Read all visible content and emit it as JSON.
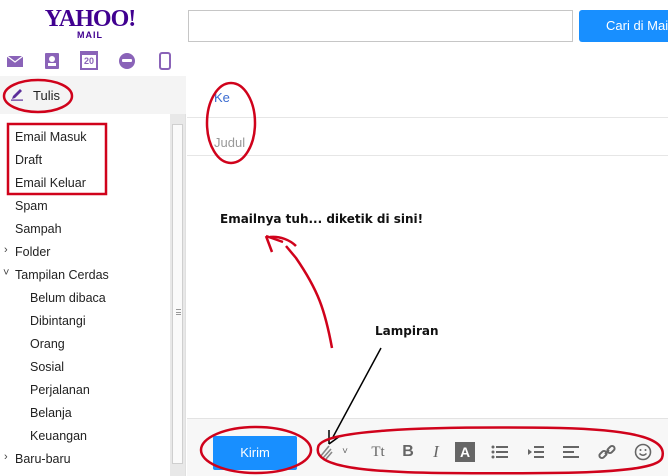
{
  "header": {
    "logo_main": "YAHOO!",
    "logo_sub": "MAIL",
    "search_button": "Cari di Mail",
    "search_value": ""
  },
  "apps": [
    "mail-icon",
    "contacts-icon",
    "calendar-icon",
    "messenger-icon",
    "mobile-icon"
  ],
  "calendar_day": "20",
  "sidebar": {
    "compose_label": "Tulis",
    "folders": [
      {
        "label": "Email Masuk"
      },
      {
        "label": "Draft"
      },
      {
        "label": "Email Keluar"
      },
      {
        "label": "Spam"
      },
      {
        "label": "Sampah"
      },
      {
        "label": "Folder"
      },
      {
        "label": "Tampilan Cerdas"
      },
      {
        "label": "Belum dibaca"
      },
      {
        "label": "Dibintangi"
      },
      {
        "label": "Orang"
      },
      {
        "label": "Sosial"
      },
      {
        "label": "Perjalanan"
      },
      {
        "label": "Belanja"
      },
      {
        "label": "Keuangan"
      },
      {
        "label": "Baru-baru"
      }
    ]
  },
  "compose": {
    "to_label": "Ke",
    "subject_placeholder": "Judul",
    "body_text": "Emailnya tuh... diketik di sini!",
    "attachment_annotation": "Lampiran",
    "send_label": "Kirim",
    "toolbar": {
      "text_size": "Tt",
      "bold": "B",
      "italic": "I",
      "text_color": "A"
    }
  },
  "colors": {
    "brand": "#400090",
    "accent": "#188fff",
    "annotation": "#d0021b"
  }
}
